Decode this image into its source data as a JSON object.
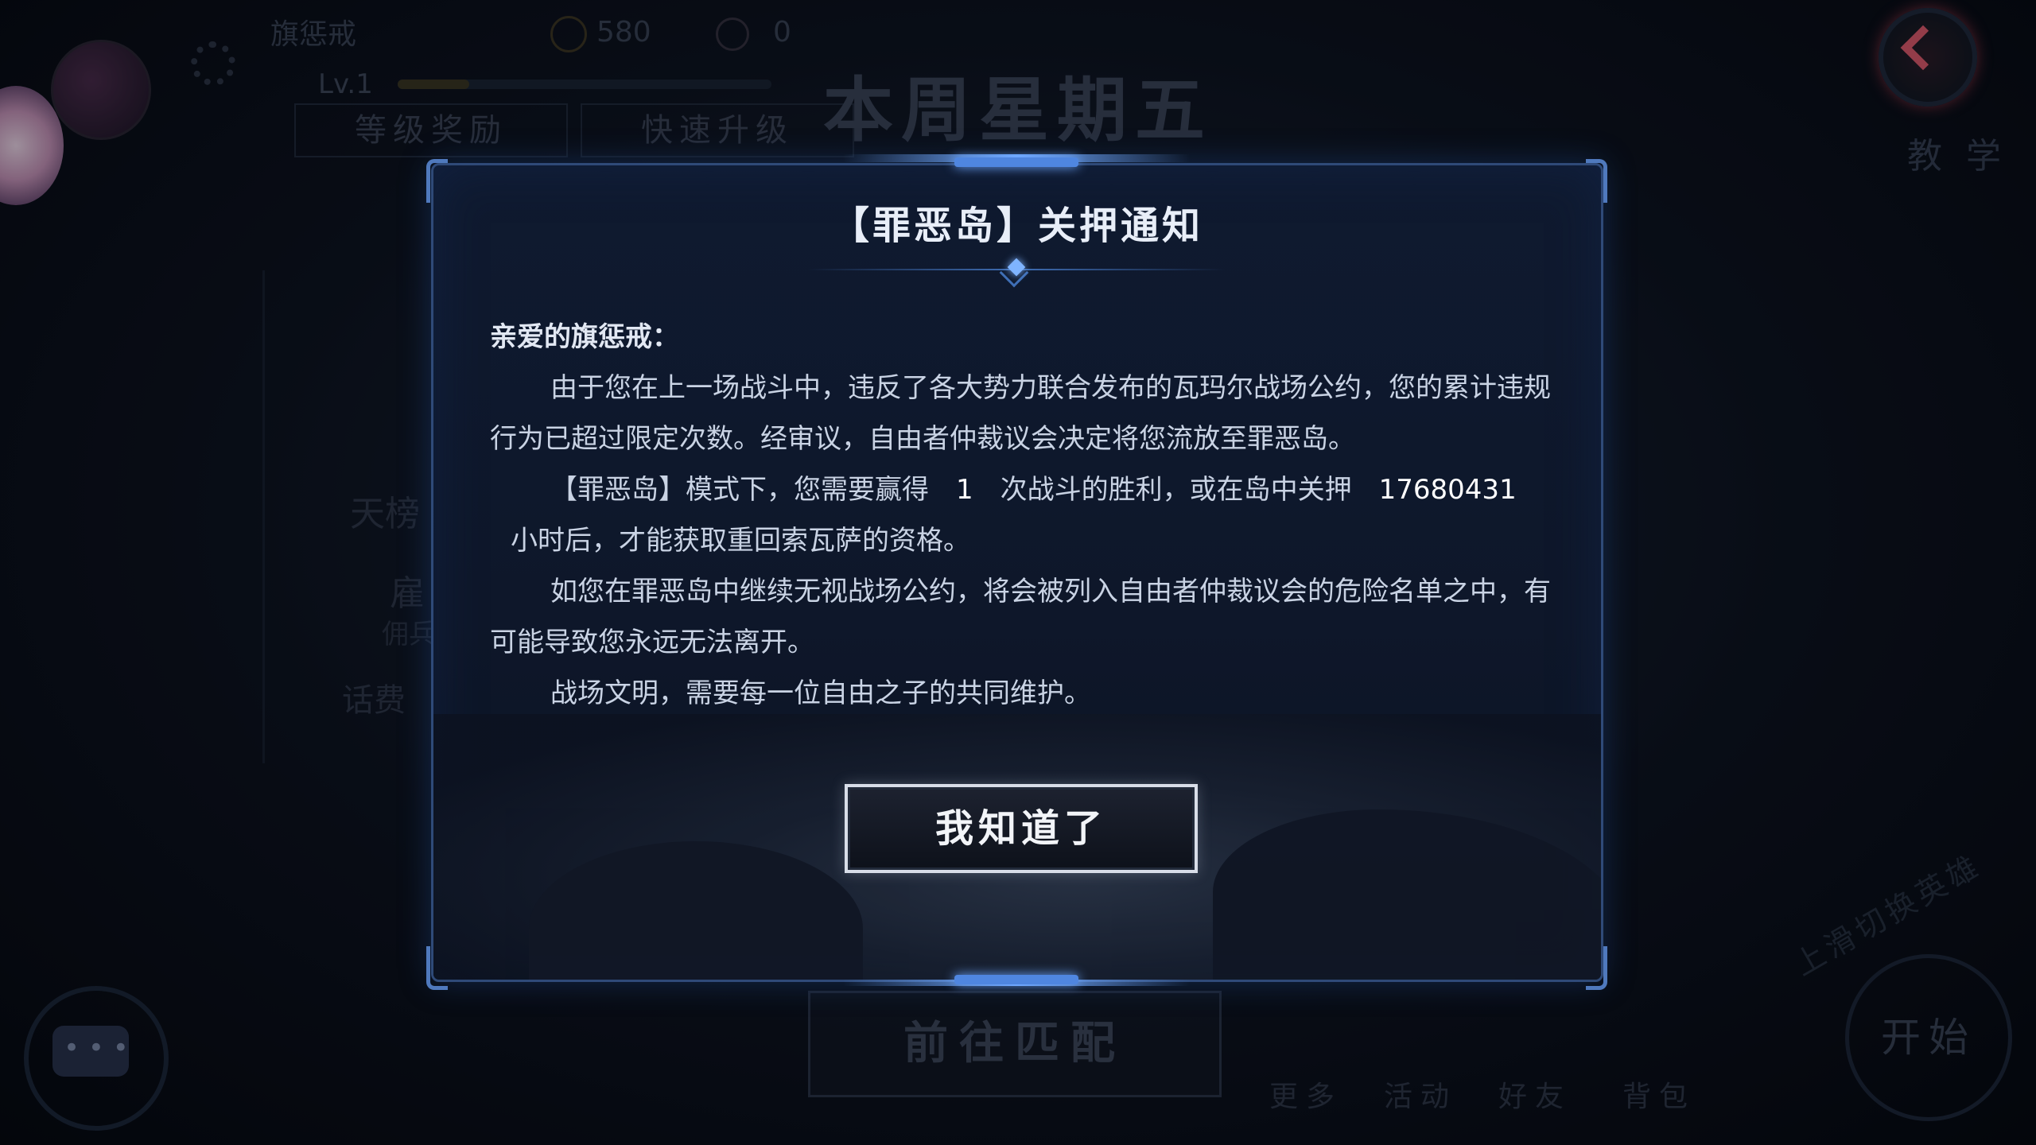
{
  "background": {
    "username": "旗惩戒",
    "gold": "580",
    "gems": "0",
    "level": "Lv.1",
    "tabs": [
      "等级奖励",
      "快速升级"
    ],
    "week_title": "本周星期五",
    "teach_label": "教学",
    "side_labels": [
      "天榜",
      "雇",
      "佣兵",
      "话费"
    ],
    "match_button": "前往匹配",
    "bottom_nav": [
      "更多",
      "活动",
      "好友",
      "背包"
    ],
    "start_button": "开始",
    "swipe_hint": "上滑切换英雄"
  },
  "dialog": {
    "title": "【罪恶岛】关押通知",
    "greeting": "亲爱的旗惩戒：",
    "p1": "由于您在上一场战斗中，违反了各大势力联合发布的瓦玛尔战场公约，您的累计违规行为已超过限定次数。经审议，自由者仲裁议会决定将您流放至罪恶岛。",
    "p2_a": "【罪恶岛】模式下，您需要赢得",
    "p2_wins": "1",
    "p2_b": "次战斗的胜利，或在岛中关押",
    "p2_hours": "17680431",
    "p2_c": "小时后，才能获取重回索瓦萨的资格。",
    "p3": "如您在罪恶岛中继续无视战场公约，将会被列入自由者仲裁议会的危险名单之中，有可能导致您永远无法离开。",
    "p4": "战场文明，需要每一位自由之子的共同维护。",
    "confirm_button": "我知道了"
  }
}
